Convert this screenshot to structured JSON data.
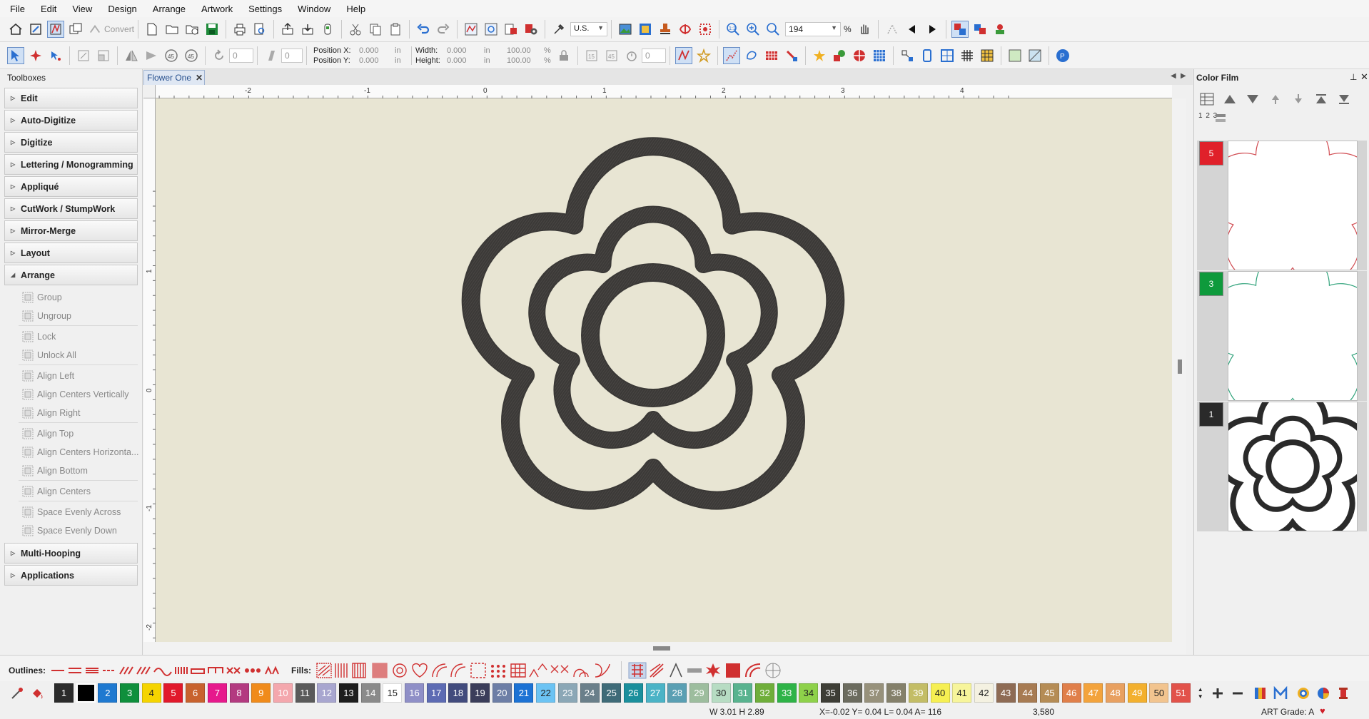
{
  "menu": [
    "File",
    "Edit",
    "View",
    "Design",
    "Arrange",
    "Artwork",
    "Settings",
    "Window",
    "Help"
  ],
  "toolbar1": {
    "convert_label": "Convert",
    "units_value": "U.S.",
    "zoom_value": "194",
    "zoom_unit": "%"
  },
  "toolbar2": {
    "rotate_value": "0",
    "slant_value": "0",
    "count_value": "0",
    "position_x_label": "Position X:",
    "position_x_value": "0.000",
    "position_x_unit": "in",
    "position_y_label": "Position Y:",
    "position_y_value": "0.000",
    "position_y_unit": "in",
    "width_label": "Width:",
    "width_value": "0.000",
    "width_unit": "in",
    "width_pct": "100.00",
    "width_pct_unit": "%",
    "height_label": "Height:",
    "height_value": "0.000",
    "height_unit": "in",
    "height_pct": "100.00",
    "height_pct_unit": "%"
  },
  "toolboxes": {
    "title": "Toolboxes",
    "sections_before": [
      "Edit",
      "Auto-Digitize",
      "Digitize",
      "Lettering / Monogramming",
      "Appliqué",
      "CutWork / StumpWork",
      "Mirror-Merge",
      "Layout"
    ],
    "open_section": "Arrange",
    "arrange_groups": [
      [
        "Group",
        "Ungroup"
      ],
      [
        "Lock",
        "Unlock All"
      ],
      [
        "Align Left",
        "Align Centers Vertically",
        "Align Right"
      ],
      [
        "Align Top",
        "Align Centers Horizonta...",
        "Align Bottom"
      ],
      [
        "Align Centers"
      ],
      [
        "Space Evenly Across",
        "Space Evenly Down"
      ]
    ],
    "sections_after": [
      "Multi-Hooping",
      "Applications"
    ]
  },
  "document": {
    "tab_title": "Flower One",
    "ruler_top": [
      "-2",
      "-1",
      "0",
      "1",
      "2",
      "3",
      "4"
    ],
    "ruler_left": [
      "-2",
      "-1",
      "0",
      "1"
    ]
  },
  "color_film": {
    "title": "Color Film",
    "order_label": "1 2 3",
    "entries": [
      {
        "number": "5",
        "color": "#e0202a",
        "outline": "#d04a50"
      },
      {
        "number": "3",
        "color": "#0e9a3c",
        "outline": "#2fa27a"
      },
      {
        "number": "1",
        "color": "#2a2a2a",
        "outline": "#333333"
      }
    ]
  },
  "outline_bar": {
    "outlines_label": "Outlines:",
    "fills_label": "Fills:"
  },
  "palette": [
    {
      "n": "1",
      "c": "#2b2b2b",
      "t": "#fff"
    },
    {
      "n": "",
      "c": "#000000",
      "t": "#fff",
      "sel": true
    },
    {
      "n": "2",
      "c": "#1f79d0",
      "t": "#fff"
    },
    {
      "n": "3",
      "c": "#0f8f3c",
      "t": "#fff"
    },
    {
      "n": "4",
      "c": "#f5d400",
      "t": "#222"
    },
    {
      "n": "5",
      "c": "#e1192b",
      "t": "#fff"
    },
    {
      "n": "6",
      "c": "#c8622e",
      "t": "#fff"
    },
    {
      "n": "7",
      "c": "#e6198c",
      "t": "#fff"
    },
    {
      "n": "8",
      "c": "#b33a80",
      "t": "#fff"
    },
    {
      "n": "9",
      "c": "#f08b1b",
      "t": "#fff"
    },
    {
      "n": "10",
      "c": "#f4a7ad",
      "t": "#fff"
    },
    {
      "n": "11",
      "c": "#5a5a5a",
      "t": "#fff"
    },
    {
      "n": "12",
      "c": "#a8a6cf",
      "t": "#fff"
    },
    {
      "n": "13",
      "c": "#1e1e1e",
      "t": "#fff"
    },
    {
      "n": "14",
      "c": "#8a8a8a",
      "t": "#fff"
    },
    {
      "n": "15",
      "c": "#ffffff",
      "t": "#222"
    },
    {
      "n": "16",
      "c": "#8f8fc7",
      "t": "#fff"
    },
    {
      "n": "17",
      "c": "#5d6bb3",
      "t": "#fff"
    },
    {
      "n": "18",
      "c": "#424b7d",
      "t": "#fff"
    },
    {
      "n": "19",
      "c": "#3b3d5a",
      "t": "#fff"
    },
    {
      "n": "20",
      "c": "#6d7ea6",
      "t": "#fff"
    },
    {
      "n": "21",
      "c": "#1c72d4",
      "t": "#fff"
    },
    {
      "n": "22",
      "c": "#6cc3f3",
      "t": "#222"
    },
    {
      "n": "23",
      "c": "#8ba7b6",
      "t": "#fff"
    },
    {
      "n": "24",
      "c": "#6a7f8a",
      "t": "#fff"
    },
    {
      "n": "25",
      "c": "#3f6b78",
      "t": "#fff"
    },
    {
      "n": "26",
      "c": "#1b8f9c",
      "t": "#fff"
    },
    {
      "n": "27",
      "c": "#4bb3c6",
      "t": "#fff"
    },
    {
      "n": "28",
      "c": "#5a9fb3",
      "t": "#fff"
    },
    {
      "n": "29",
      "c": "#9dbd9e",
      "t": "#fff"
    },
    {
      "n": "30",
      "c": "#b7dcc3",
      "t": "#222"
    },
    {
      "n": "31",
      "c": "#59b38f",
      "t": "#fff"
    },
    {
      "n": "32",
      "c": "#6fae3a",
      "t": "#fff"
    },
    {
      "n": "33",
      "c": "#2eb347",
      "t": "#fff"
    },
    {
      "n": "34",
      "c": "#8ed14a",
      "t": "#222"
    },
    {
      "n": "35",
      "c": "#3e3e36",
      "t": "#fff"
    },
    {
      "n": "36",
      "c": "#6b6b5e",
      "t": "#fff"
    },
    {
      "n": "37",
      "c": "#97917b",
      "t": "#fff"
    },
    {
      "n": "38",
      "c": "#84806a",
      "t": "#fff"
    },
    {
      "n": "39",
      "c": "#c3bd66",
      "t": "#fff"
    },
    {
      "n": "40",
      "c": "#f6ef52",
      "t": "#222"
    },
    {
      "n": "41",
      "c": "#f7f59b",
      "t": "#222"
    },
    {
      "n": "42",
      "c": "#f4f1e1",
      "t": "#222"
    },
    {
      "n": "43",
      "c": "#8e6b54",
      "t": "#fff"
    },
    {
      "n": "44",
      "c": "#a77b52",
      "t": "#fff"
    },
    {
      "n": "45",
      "c": "#b58c55",
      "t": "#fff"
    },
    {
      "n": "46",
      "c": "#e07f4a",
      "t": "#fff"
    },
    {
      "n": "47",
      "c": "#f3a33c",
      "t": "#fff"
    },
    {
      "n": "48",
      "c": "#e8a060",
      "t": "#fff"
    },
    {
      "n": "49",
      "c": "#f3b02e",
      "t": "#fff"
    },
    {
      "n": "50",
      "c": "#f2c48f",
      "t": "#222"
    },
    {
      "n": "51",
      "c": "#e2524a",
      "t": "#fff"
    }
  ],
  "status": {
    "size": "W 3.01  H 2.89",
    "coords": "X=-0.02  Y= 0.04  L= 0.04  A= 116",
    "stitches": "3,580",
    "grade": "ART Grade: A"
  },
  "colors": {
    "accent": "#2a6fd0",
    "thread_dark": "#3a3a3a",
    "canvas": "#e8e5d3"
  }
}
